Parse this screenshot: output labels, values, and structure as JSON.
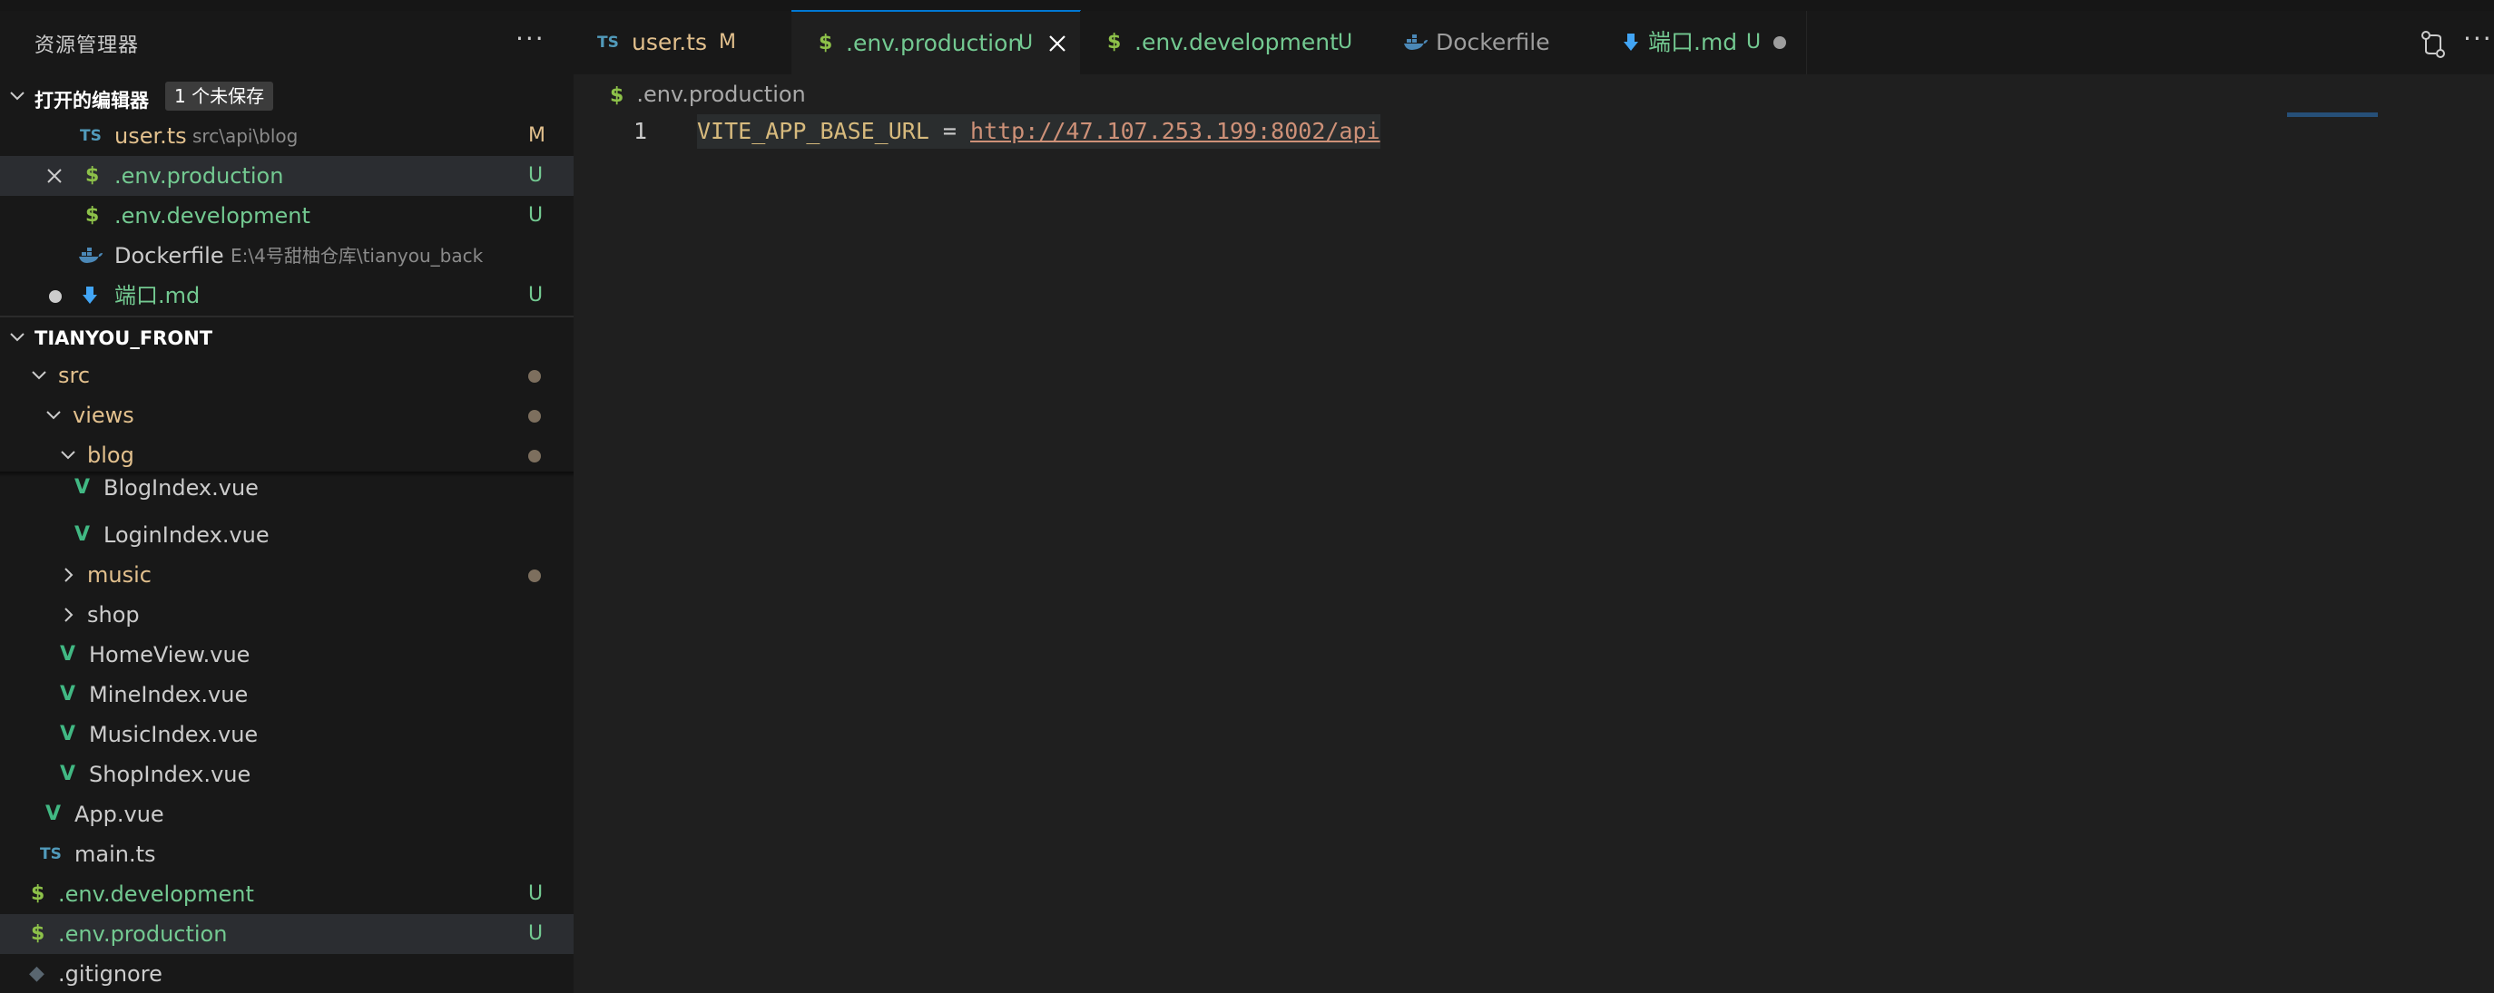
{
  "sidebar": {
    "title": "资源管理器",
    "more": "···",
    "open_editors": {
      "title": "打开的编辑器",
      "badge": "1 个未保存",
      "items": [
        {
          "icon": "TS",
          "label": "user.ts",
          "desc": "src\\api\\blog",
          "status": "M"
        },
        {
          "icon": "$",
          "label": ".env.production",
          "status": "U"
        },
        {
          "icon": "$",
          "label": ".env.development",
          "status": "U"
        },
        {
          "icon": "docker",
          "label": "Dockerfile",
          "desc": "E:\\4号甜柚仓库\\tianyou_back",
          "status": ""
        },
        {
          "icon": "md",
          "label": "端口.md",
          "status": "U"
        }
      ]
    },
    "project": {
      "title": "TIANYOU_FRONT",
      "tree": [
        {
          "label": "src"
        },
        {
          "label": "views"
        },
        {
          "label": "blog"
        },
        {
          "icon": "V",
          "label": "BlogIndex.vue"
        },
        {
          "icon": "V",
          "label": "LoginIndex.vue"
        },
        {
          "label": "music"
        },
        {
          "label": "shop"
        },
        {
          "icon": "V",
          "label": "HomeView.vue"
        },
        {
          "icon": "V",
          "label": "MineIndex.vue"
        },
        {
          "icon": "V",
          "label": "MusicIndex.vue"
        },
        {
          "icon": "V",
          "label": "ShopIndex.vue"
        },
        {
          "icon": "V",
          "label": "App.vue"
        },
        {
          "icon": "TS",
          "label": "main.ts"
        },
        {
          "icon": "$",
          "label": ".env.development",
          "status": "U"
        },
        {
          "icon": "$",
          "label": ".env.production",
          "status": "U"
        },
        {
          "icon": "◆",
          "label": ".gitignore"
        }
      ]
    }
  },
  "tabs": [
    {
      "icon": "TS",
      "label": "user.ts",
      "status": "M"
    },
    {
      "icon": "$",
      "label": ".env.production",
      "status": "U"
    },
    {
      "icon": "$",
      "label": ".env.development",
      "status": "U"
    },
    {
      "icon": "docker",
      "label": "Dockerfile"
    },
    {
      "icon": "md",
      "label": "端口.md",
      "status": "U"
    }
  ],
  "actions": {
    "more": "···"
  },
  "editor": {
    "breadcrumb_icon": "$",
    "breadcrumb": ".env.production",
    "line_number": "1",
    "code_key": "VITE_APP_BASE_URL",
    "code_eq": " = ",
    "code_url": "http://47.107.253.199:8002/api"
  },
  "colors": {
    "modified": "#e2c08d",
    "untracked": "#73c991",
    "accent": "#0078d4",
    "vue": "#41b883",
    "env": "#8dc149"
  }
}
